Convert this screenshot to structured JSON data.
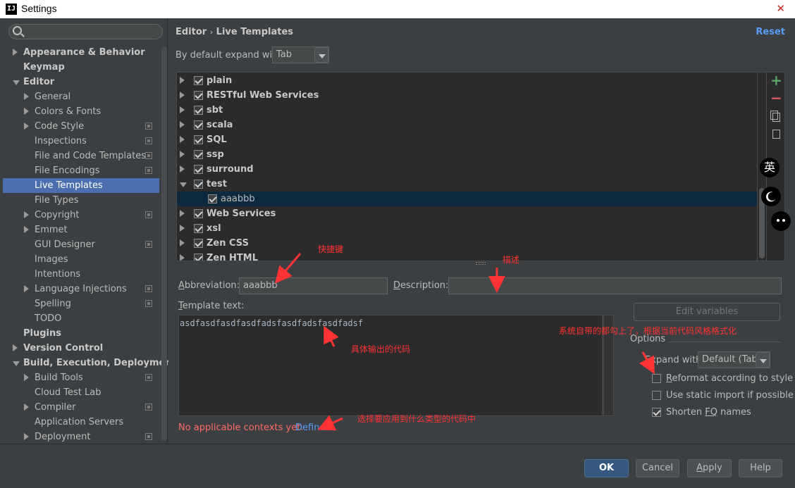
{
  "window": {
    "title": "Settings",
    "app_icon": "IJ"
  },
  "search": {
    "placeholder": ""
  },
  "sidebar": {
    "items": [
      {
        "label": "Appearance & Behavior",
        "bold": true,
        "arrow": "right",
        "indent": 0,
        "proj": false
      },
      {
        "label": "Keymap",
        "bold": true,
        "arrow": "",
        "indent": 0,
        "proj": false
      },
      {
        "label": "Editor",
        "bold": true,
        "arrow": "down",
        "indent": 0,
        "proj": false
      },
      {
        "label": "General",
        "bold": false,
        "arrow": "right",
        "indent": 1,
        "proj": false
      },
      {
        "label": "Colors & Fonts",
        "bold": false,
        "arrow": "right",
        "indent": 1,
        "proj": false
      },
      {
        "label": "Code Style",
        "bold": false,
        "arrow": "right",
        "indent": 1,
        "proj": true
      },
      {
        "label": "Inspections",
        "bold": false,
        "arrow": "",
        "indent": 1,
        "proj": true
      },
      {
        "label": "File and Code Templates",
        "bold": false,
        "arrow": "",
        "indent": 1,
        "proj": true
      },
      {
        "label": "File Encodings",
        "bold": false,
        "arrow": "",
        "indent": 1,
        "proj": true
      },
      {
        "label": "Live Templates",
        "bold": false,
        "arrow": "",
        "indent": 1,
        "proj": false,
        "selected": true
      },
      {
        "label": "File Types",
        "bold": false,
        "arrow": "",
        "indent": 1,
        "proj": false
      },
      {
        "label": "Copyright",
        "bold": false,
        "arrow": "right",
        "indent": 1,
        "proj": true
      },
      {
        "label": "Emmet",
        "bold": false,
        "arrow": "right",
        "indent": 1,
        "proj": false
      },
      {
        "label": "GUI Designer",
        "bold": false,
        "arrow": "",
        "indent": 1,
        "proj": true
      },
      {
        "label": "Images",
        "bold": false,
        "arrow": "",
        "indent": 1,
        "proj": false
      },
      {
        "label": "Intentions",
        "bold": false,
        "arrow": "",
        "indent": 1,
        "proj": false
      },
      {
        "label": "Language Injections",
        "bold": false,
        "arrow": "right",
        "indent": 1,
        "proj": true
      },
      {
        "label": "Spelling",
        "bold": false,
        "arrow": "",
        "indent": 1,
        "proj": true
      },
      {
        "label": "TODO",
        "bold": false,
        "arrow": "",
        "indent": 1,
        "proj": false
      },
      {
        "label": "Plugins",
        "bold": true,
        "arrow": "",
        "indent": 0,
        "proj": false
      },
      {
        "label": "Version Control",
        "bold": true,
        "arrow": "right",
        "indent": 0,
        "proj": false
      },
      {
        "label": "Build, Execution, Deployment",
        "bold": true,
        "arrow": "down",
        "indent": 0,
        "proj": false
      },
      {
        "label": "Build Tools",
        "bold": false,
        "arrow": "right",
        "indent": 1,
        "proj": true
      },
      {
        "label": "Cloud Test Lab",
        "bold": false,
        "arrow": "",
        "indent": 1,
        "proj": false
      },
      {
        "label": "Compiler",
        "bold": false,
        "arrow": "right",
        "indent": 1,
        "proj": true
      },
      {
        "label": "Application Servers",
        "bold": false,
        "arrow": "",
        "indent": 1,
        "proj": false
      },
      {
        "label": "Deployment",
        "bold": false,
        "arrow": "right",
        "indent": 1,
        "proj": true
      }
    ]
  },
  "header": {
    "breadcrumb_parent": "Editor",
    "breadcrumb_sep": "›",
    "breadcrumb_current": "Live Templates",
    "reset_label": "Reset"
  },
  "expand": {
    "label": "By default expand with",
    "value": "Tab"
  },
  "templates": [
    {
      "name": "plain",
      "group": true,
      "checked": true,
      "arrow": "right"
    },
    {
      "name": "RESTful Web Services",
      "group": true,
      "checked": true,
      "arrow": "right"
    },
    {
      "name": "sbt",
      "group": true,
      "checked": true,
      "arrow": "right"
    },
    {
      "name": "scala",
      "group": true,
      "checked": true,
      "arrow": "right"
    },
    {
      "name": "SQL",
      "group": true,
      "checked": true,
      "arrow": "right"
    },
    {
      "name": "ssp",
      "group": true,
      "checked": true,
      "arrow": "right"
    },
    {
      "name": "surround",
      "group": true,
      "checked": true,
      "arrow": "right"
    },
    {
      "name": "test",
      "group": true,
      "checked": true,
      "arrow": "down"
    },
    {
      "name": "aaabbb",
      "group": false,
      "checked": true,
      "arrow": "",
      "selected": true
    },
    {
      "name": "Web Services",
      "group": true,
      "checked": true,
      "arrow": "right"
    },
    {
      "name": "xsl",
      "group": true,
      "checked": true,
      "arrow": "right"
    },
    {
      "name": "Zen CSS",
      "group": true,
      "checked": true,
      "arrow": "right"
    },
    {
      "name": "Zen HTML",
      "group": true,
      "checked": true,
      "arrow": "right"
    }
  ],
  "editor": {
    "abbreviation_label_a": "A",
    "abbreviation_label_rest": "bbreviation:",
    "abbreviation_value": "aaabbb",
    "description_label_a": "D",
    "description_label_rest": "escription:",
    "description_value": "",
    "template_text_label_a": "T",
    "template_text_label_rest": "emplate text:",
    "template_text_value": "asdfasdfasdfasdfadsfasdfadsfasdfadsf",
    "edit_variables_label": "Edit variables",
    "options_label": "Options",
    "expand_with_label_a": "E",
    "expand_with_label_rest": "xpand with",
    "expand_with_value": "Default (Tab)",
    "opt_reformat_a": "R",
    "opt_reformat_rest": "eformat according to style",
    "opt_reformat_checked": false,
    "opt_static_import": "Use static import if possible",
    "opt_static_import_checked": false,
    "opt_shorten_pre": "Shorten ",
    "opt_shorten_fq": "FQ",
    "opt_shorten_post": " names",
    "opt_shorten_checked": true,
    "no_contexts": "No applicable contexts yet.",
    "define_link": "Define"
  },
  "footer": {
    "ok_label": "OK",
    "cancel_label": "Cancel",
    "apply_label_a": "A",
    "apply_label_rest": "pply",
    "help_label": "Help"
  },
  "annotations": {
    "shortcut": "快捷键",
    "description": "描述",
    "output_code": "具体输出的代码",
    "reformat_note": "系统自带的都勾上了，根据当前代码风格格式化",
    "context_note": "选择要应用到什么类型的代码中"
  },
  "overlay": {
    "ime_label": "英",
    "moon_icon": "moon-icon",
    "face_icon": "face-icon"
  },
  "colors": {
    "accent": "#4b6eaf",
    "link": "#589df6",
    "error": "#ff6b68",
    "annotation": "#ff3333",
    "background": "#3c3f41"
  }
}
